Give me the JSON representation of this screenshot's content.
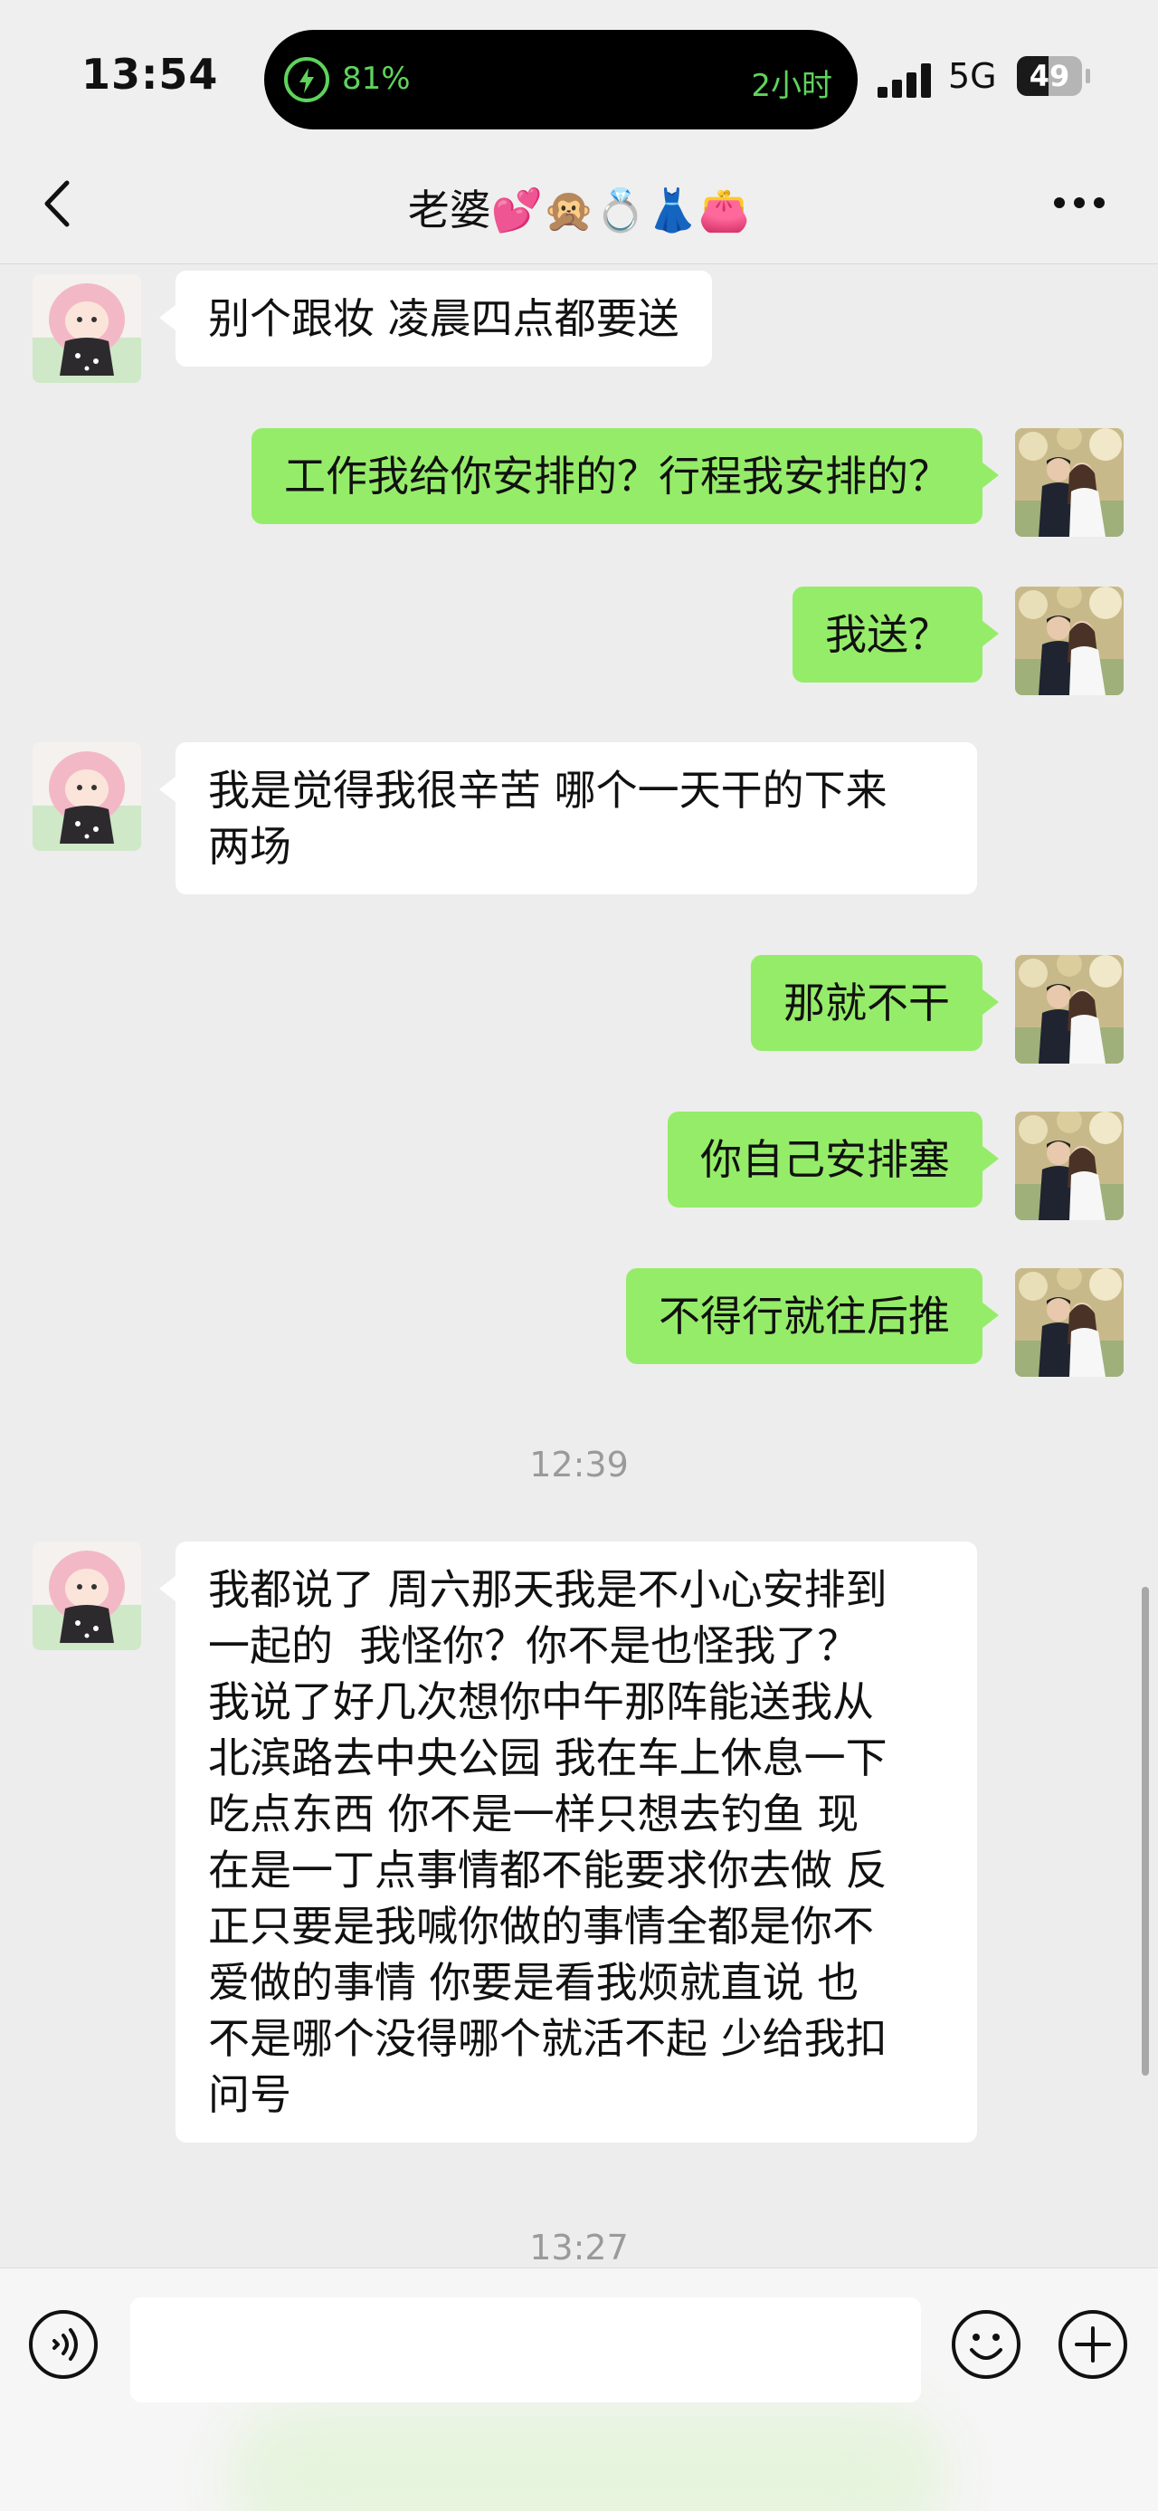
{
  "status_bar": {
    "time": "13:54",
    "battery_activity_pct": "81%",
    "duration": "2小时",
    "network": "5G",
    "battery_level": "49",
    "battery_fraction": 0.49
  },
  "nav": {
    "title": "老婆💕🙊💍👗👛",
    "back_icon": "chevron-left-icon",
    "more_icon": "more-dots-icon"
  },
  "messages": [
    {
      "from": "her",
      "text": "别个跟妆 凌晨四点都要送"
    },
    {
      "from": "me",
      "text": "工作我给你安排的？行程我安排的？"
    },
    {
      "from": "me",
      "text": "我送？"
    },
    {
      "from": "her",
      "text": "我是觉得我很辛苦 哪个一天干的下来\n两场"
    },
    {
      "from": "me",
      "text": "那就不干"
    },
    {
      "from": "me",
      "text": "你自己安排塞"
    },
    {
      "from": "me",
      "text": "不得行就往后推"
    },
    {
      "type": "time",
      "text": "12:39"
    },
    {
      "from": "her",
      "text": "我都说了 周六那天我是不小心安排到\n一起的  我怪你？你不是也怪我了？\n我说了好几次想你中午那阵能送我从\n北滨路去中央公园 我在车上休息一下\n吃点东西 你不是一样只想去钓鱼 现\n在是一丁点事情都不能要求你去做 反\n正只要是我喊你做的事情全都是你不\n爱做的事情 你要是看我烦就直说 也\n不是哪个没得哪个就活不起 少给我扣\n问号"
    },
    {
      "type": "time",
      "text": "13:27"
    }
  ],
  "input_bar": {
    "voice_icon": "voice-input-icon",
    "emoji_icon": "emoji-icon",
    "plus_icon": "plus-icon",
    "text_value": ""
  },
  "colors": {
    "background": "#ededed",
    "sent_bubble": "#95ec69",
    "received_bubble": "#ffffff",
    "island_accent": "#5fd35c"
  }
}
